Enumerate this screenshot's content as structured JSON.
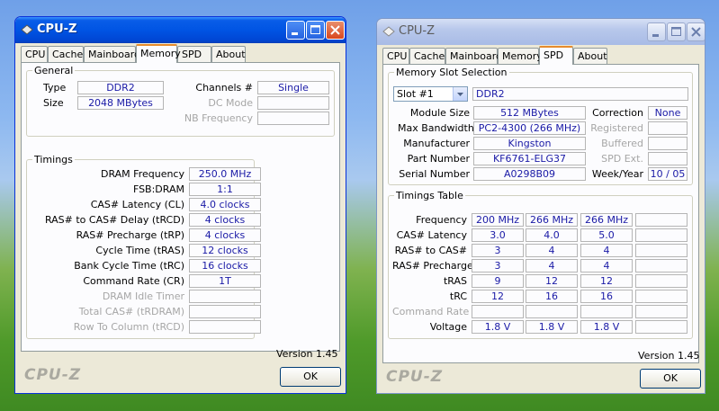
{
  "left": {
    "title": "CPU-Z",
    "tabs": [
      "CPU",
      "Cache",
      "Mainboard",
      "Memory",
      "SPD",
      "About"
    ],
    "active_tab": "Memory",
    "general": {
      "label": "General",
      "type_label": "Type",
      "type_value": "DDR2",
      "size_label": "Size",
      "size_value": "2048 MBytes",
      "channels_label": "Channels #",
      "channels_value": "Single",
      "dc_mode_label": "DC Mode",
      "dc_mode_value": "",
      "nb_freq_label": "NB Frequency",
      "nb_freq_value": ""
    },
    "timings": {
      "label": "Timings",
      "rows": [
        {
          "label": "DRAM Frequency",
          "value": "250.0 MHz",
          "enabled": true
        },
        {
          "label": "FSB:DRAM",
          "value": "1:1",
          "enabled": true
        },
        {
          "label": "CAS# Latency (CL)",
          "value": "4.0 clocks",
          "enabled": true
        },
        {
          "label": "RAS# to CAS# Delay (tRCD)",
          "value": "4 clocks",
          "enabled": true
        },
        {
          "label": "RAS# Precharge (tRP)",
          "value": "4 clocks",
          "enabled": true
        },
        {
          "label": "Cycle Time (tRAS)",
          "value": "12 clocks",
          "enabled": true
        },
        {
          "label": "Bank Cycle Time (tRC)",
          "value": "16 clocks",
          "enabled": true
        },
        {
          "label": "Command Rate (CR)",
          "value": "1T",
          "enabled": true
        },
        {
          "label": "DRAM Idle Timer",
          "value": "",
          "enabled": false
        },
        {
          "label": "Total CAS# (tRDRAM)",
          "value": "",
          "enabled": false
        },
        {
          "label": "Row To Column (tRCD)",
          "value": "",
          "enabled": false
        }
      ]
    },
    "version": "Version 1.45",
    "brand": "CPU-Z",
    "ok_label": "OK"
  },
  "right": {
    "title": "CPU-Z",
    "tabs": [
      "CPU",
      "Cache",
      "Mainboard",
      "Memory",
      "SPD",
      "About"
    ],
    "active_tab": "SPD",
    "slot": {
      "label": "Memory Slot Selection",
      "selected": "Slot #1",
      "type_value": "DDR2",
      "module_size_label": "Module Size",
      "module_size_value": "512 MBytes",
      "max_bw_label": "Max Bandwidth",
      "max_bw_value": "PC2-4300 (266 MHz)",
      "manufacturer_label": "Manufacturer",
      "manufacturer_value": "Kingston",
      "part_label": "Part Number",
      "part_value": "KF6761-ELG37",
      "serial_label": "Serial Number",
      "serial_value": "A0298B09",
      "correction_label": "Correction",
      "correction_value": "None",
      "registered_label": "Registered",
      "registered_value": "",
      "buffered_label": "Buffered",
      "buffered_value": "",
      "spd_ext_label": "SPD Ext.",
      "spd_ext_value": "",
      "week_year_label": "Week/Year",
      "week_year_value": "10 / 05"
    },
    "timings_table": {
      "label": "Timings Table",
      "rows": [
        {
          "label": "Frequency",
          "values": [
            "200 MHz",
            "266 MHz",
            "266 MHz",
            ""
          ],
          "enabled": true
        },
        {
          "label": "CAS# Latency",
          "values": [
            "3.0",
            "4.0",
            "5.0",
            ""
          ],
          "enabled": true
        },
        {
          "label": "RAS# to CAS#",
          "values": [
            "3",
            "4",
            "4",
            ""
          ],
          "enabled": true
        },
        {
          "label": "RAS# Precharge",
          "values": [
            "3",
            "4",
            "4",
            ""
          ],
          "enabled": true
        },
        {
          "label": "tRAS",
          "values": [
            "9",
            "12",
            "12",
            ""
          ],
          "enabled": true
        },
        {
          "label": "tRC",
          "values": [
            "12",
            "16",
            "16",
            ""
          ],
          "enabled": true
        },
        {
          "label": "Command Rate",
          "values": [
            "",
            "",
            "",
            ""
          ],
          "enabled": false
        },
        {
          "label": "Voltage",
          "values": [
            "1.8 V",
            "1.8 V",
            "1.8 V",
            ""
          ],
          "enabled": true
        }
      ]
    },
    "version": "Version 1.45",
    "brand": "CPU-Z",
    "ok_label": "OK"
  }
}
